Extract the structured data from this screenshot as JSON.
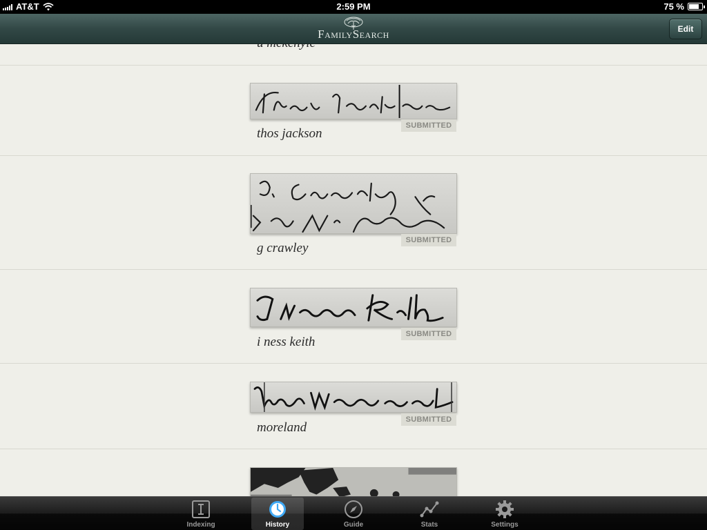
{
  "status_bar": {
    "carrier": "AT&T",
    "time": "2:59 PM",
    "battery_text": "75 %",
    "battery_level": 0.75
  },
  "nav_bar": {
    "logo_text": "FamilySearch",
    "edit_label": "Edit"
  },
  "history": {
    "items": [
      {
        "name": "u mckenyie",
        "status": ""
      },
      {
        "name": "thos jackson",
        "status": "SUBMITTED"
      },
      {
        "name": "g crawley",
        "status": "SUBMITTED"
      },
      {
        "name": "i ness keith",
        "status": "SUBMITTED"
      },
      {
        "name": "moreland",
        "status": "SUBMITTED"
      },
      {
        "name": "",
        "status": ""
      }
    ]
  },
  "tab_bar": {
    "tabs": [
      {
        "label": "Indexing",
        "icon": "indexing-icon",
        "active": false
      },
      {
        "label": "History",
        "icon": "clock-icon",
        "active": true
      },
      {
        "label": "Guide",
        "icon": "compass-icon",
        "active": false
      },
      {
        "label": "Stats",
        "icon": "stats-icon",
        "active": false
      },
      {
        "label": "Settings",
        "icon": "gear-icon",
        "active": false
      }
    ]
  },
  "colors": {
    "nav_bar": "#324846",
    "list_background": "#efefe9",
    "active_tab_icon": "#3fa9f5"
  }
}
